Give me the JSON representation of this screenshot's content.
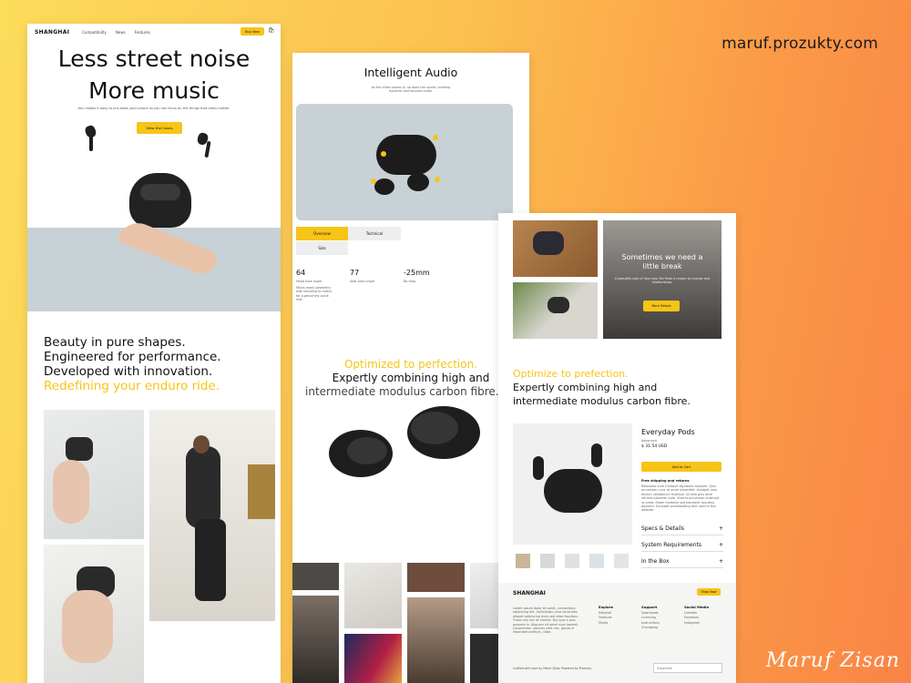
{
  "watermark": "maruf.prozukty.com",
  "signature": "Maruf Zisan",
  "colors": {
    "accent": "#f7c417",
    "photo_bg": "#c7d1d6",
    "text_yellow": "#f7c417"
  },
  "page1": {
    "logo": "SHANGHAI",
    "nav": [
      "Compatibility",
      "News",
      "Features"
    ],
    "buy_button": "Buy Now",
    "cart_icon": "cart-icon",
    "cart_count": "0",
    "hero_line1": "Less street noise",
    "hero_line2": "More music",
    "hero_sub": "Anc makes it easy to put down your phone so you can focus on the things that really matter.",
    "cta": "View the Cases",
    "section_lines": [
      "Beauty in pure shapes.",
      "Engineered for performance.",
      "Developed with innovation."
    ],
    "section_yellow": "Redefining your enduro ride."
  },
  "page2": {
    "title": "Intelligent Audio",
    "subtitle": "As the video zooms in, so does the sound, creating dynamic and focused audio.",
    "tabs": [
      "Overview",
      "Technical",
      "Size"
    ],
    "stats": [
      {
        "value": "64",
        "label": "Head tube angle",
        "desc": "Maxis ready geometry with handling to match, for a genuinely quick ride."
      },
      {
        "value": "77",
        "label": "Seat tube angle",
        "desc": ""
      },
      {
        "value": "-25mm",
        "label": "Bb drop",
        "desc": ""
      }
    ],
    "yellow_heading": "Optimized to perfection.",
    "heading_line1": "Expertly combining high and",
    "heading_line2": "intermediate modulus carbon fibre."
  },
  "page3": {
    "overlay_title": "Sometimes we need a little break",
    "overlay_desc": "A beautiful look of how your life finds a reason to change and relationships.",
    "overlay_button": "More Details",
    "yellow_heading": "Optimize to prefection.",
    "heading_line1": "Expertly combining high and",
    "heading_line2": "intermediate modulus carbon fibre.",
    "product_name": "Everyday Pods",
    "product_variant": "Advanced",
    "product_price": "$ 31.54 USD",
    "add_to_cart": "Add to Cart",
    "shipping_title": "Free shipping and returns",
    "shipping_text": "Relaxedio eum tristique dignissim aliquam. Quis accumsan nunc at amet imperdiet. Volutpat iusa dictum vestibulum tristique. Ut sem quis ante ultrices placerat nulla. Viverra accumsan euismod ut amet. Etiam molestie sed hendrerit faucibus posuere. Excludes proofreading text used in this website.",
    "accordions": [
      "Specs & Details",
      "System Requirements",
      "In the Box"
    ],
    "footer": {
      "logo": "SHANGHAI",
      "shop_button": "Shop Now",
      "about": "Lorem ipsum dolor sit amet, consectetur adipiscing elit. Sollicitudin urna venenatis aliquet adipiscing risus sed vitae faucibus. Turpis nisi nec et viverra. Dui quis a quis posuere in. Aliquam sit amet risus laoreet. Consectetur ultricies velit nec, ipsum in imperdiet pretium, vitae.",
      "columns": [
        {
          "title": "Explore",
          "items": [
            "Editorial",
            "Features",
            "Shoes"
          ]
        },
        {
          "title": "Support",
          "items": [
            "Downloads",
            "Licensing",
            "Instructions",
            "Changelog"
          ]
        },
        {
          "title": "Social Media",
          "items": [
            "LinkedIn",
            "Facebook",
            "Instagram"
          ]
        }
      ],
      "credit": "Crafted with love by Maruf Zisan   Powered by Prozukty",
      "email_placeholder": "Subscribe"
    }
  }
}
